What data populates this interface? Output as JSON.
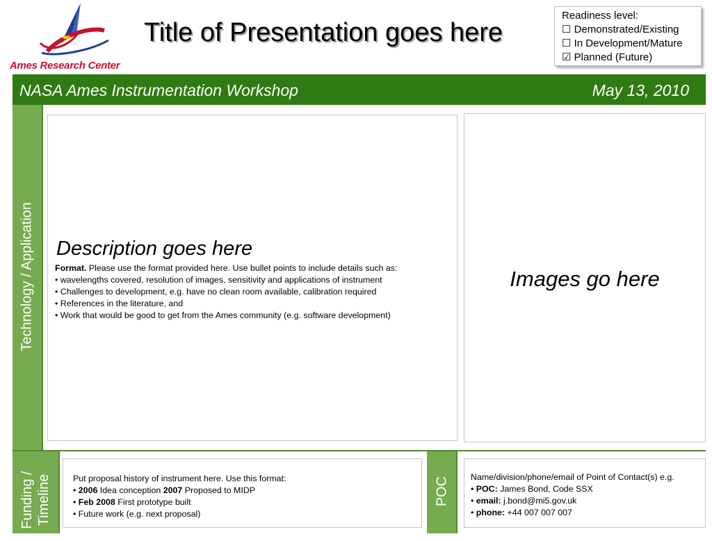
{
  "header": {
    "org_name": "Ames Research Center",
    "title": "Title of Presentation goes here"
  },
  "readiness": {
    "label": "Readiness level:",
    "options": [
      {
        "box": "☐",
        "label": "Demonstrated/Existing"
      },
      {
        "box": "☐",
        "label": "In Development/Mature"
      },
      {
        "box": "☑",
        "label": "Planned (Future)"
      }
    ]
  },
  "banner": {
    "event": "NASA Ames Instrumentation Workshop",
    "date": "May 13, 2010",
    "color": "#2f7a12"
  },
  "sections": {
    "technology_label": "Technology / Application",
    "funding_label_1": "Funding /",
    "funding_label_2": "Timeline",
    "poc_label": "POC",
    "strip_color": "#76ab4f"
  },
  "description": {
    "heading": "Description goes here",
    "format_bold": "Format.",
    "format_text": " Please use the format provided here. Use bullet points to include details such as:",
    "bullets": [
      "• wavelengths covered, resolution of images, sensitivity and applications of instrument",
      "• Challenges to development, e.g. have no clean room available, calibration required",
      "• References in the literature, and",
      "• Work that would be good to get from the Ames community (e.g. software development)"
    ]
  },
  "images": {
    "placeholder": "Images go here"
  },
  "funding": {
    "intro": "Put proposal history of instrument here. Use this format:",
    "bullet": "• ",
    "y1": "2006",
    "t1": " Idea conception ",
    "y2": "2007",
    "t2": " Proposed to MIDP",
    "y3": "Feb 2008",
    "t3": " First prototype built",
    "future": "• Future work (e.g. next proposal)"
  },
  "poc": {
    "intro": "Name/division/phone/email of Point of Contact(s) e.g.",
    "bullet": "• ",
    "poc_label": "POC:",
    "poc_value": " James Bond, Code SSX",
    "email_label": "email:",
    "email_value": " j.bond@mi5.gov.uk",
    "phone_label": "phone:",
    "phone_value": " +44 007 007 007"
  }
}
